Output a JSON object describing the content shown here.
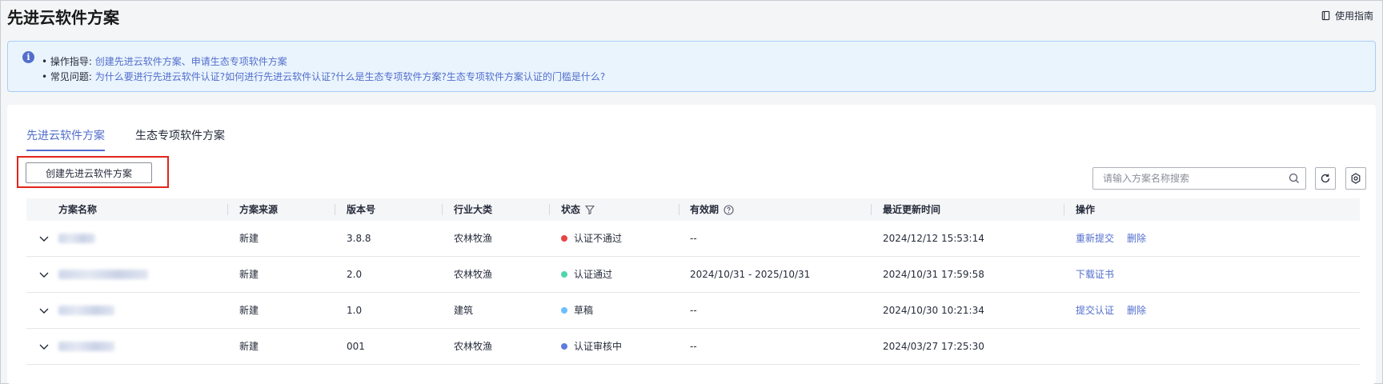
{
  "page": {
    "title": "先进云软件方案",
    "guide_label": "使用指南"
  },
  "info": {
    "line1_label": "• 操作指导:",
    "line1_links": [
      "创建先进云软件方案、",
      "申请生态专项软件方案"
    ],
    "line2_label": "• 常见问题:",
    "line2_links": [
      "为什么要进行先进云软件认证?",
      "如何进行先进云软件认证?",
      "什么是生态专项软件方案?",
      "生态专项软件方案认证的门槛是什么?"
    ]
  },
  "tabs": [
    {
      "label": "先进云软件方案",
      "active": true
    },
    {
      "label": "生态专项软件方案",
      "active": false
    }
  ],
  "toolbar": {
    "create_label": "创建先进云软件方案",
    "search_placeholder": "请输入方案名称搜索"
  },
  "table": {
    "headers": [
      "方案名称",
      "方案来源",
      "版本号",
      "行业大类",
      "状态",
      "有效期",
      "最近更新时间",
      "操作"
    ],
    "rows": [
      {
        "source": "新建",
        "version": "3.8.8",
        "industry": "农林牧渔",
        "status": "认证不通过",
        "status_color": "#e54545",
        "validity": "--",
        "updated": "2024/12/12 15:53:14",
        "actions": [
          "重新提交",
          "删除"
        ]
      },
      {
        "source": "新建",
        "version": "2.0",
        "industry": "农林牧渔",
        "status": "认证通过",
        "status_color": "#50d4ab",
        "validity": "2024/10/31 - 2025/10/31",
        "updated": "2024/10/31 17:59:58",
        "actions": [
          "下载证书"
        ]
      },
      {
        "source": "新建",
        "version": "1.0",
        "industry": "建筑",
        "status": "草稿",
        "status_color": "#6cbfff",
        "validity": "--",
        "updated": "2024/10/30 10:21:34",
        "actions": [
          "提交认证",
          "删除"
        ]
      },
      {
        "source": "新建",
        "version": "001",
        "industry": "农林牧渔",
        "status": "认证审核中",
        "status_color": "#5e7ce0",
        "validity": "--",
        "updated": "2024/03/27 17:25:30",
        "actions": []
      }
    ]
  },
  "colors": {
    "accent": "#526ecc",
    "highlight_border": "#e1251b"
  },
  "icons": [
    "book-icon",
    "info-icon",
    "search-icon",
    "refresh-icon",
    "gear-icon",
    "filter-icon",
    "help-circle-icon",
    "chevron-down-icon"
  ]
}
